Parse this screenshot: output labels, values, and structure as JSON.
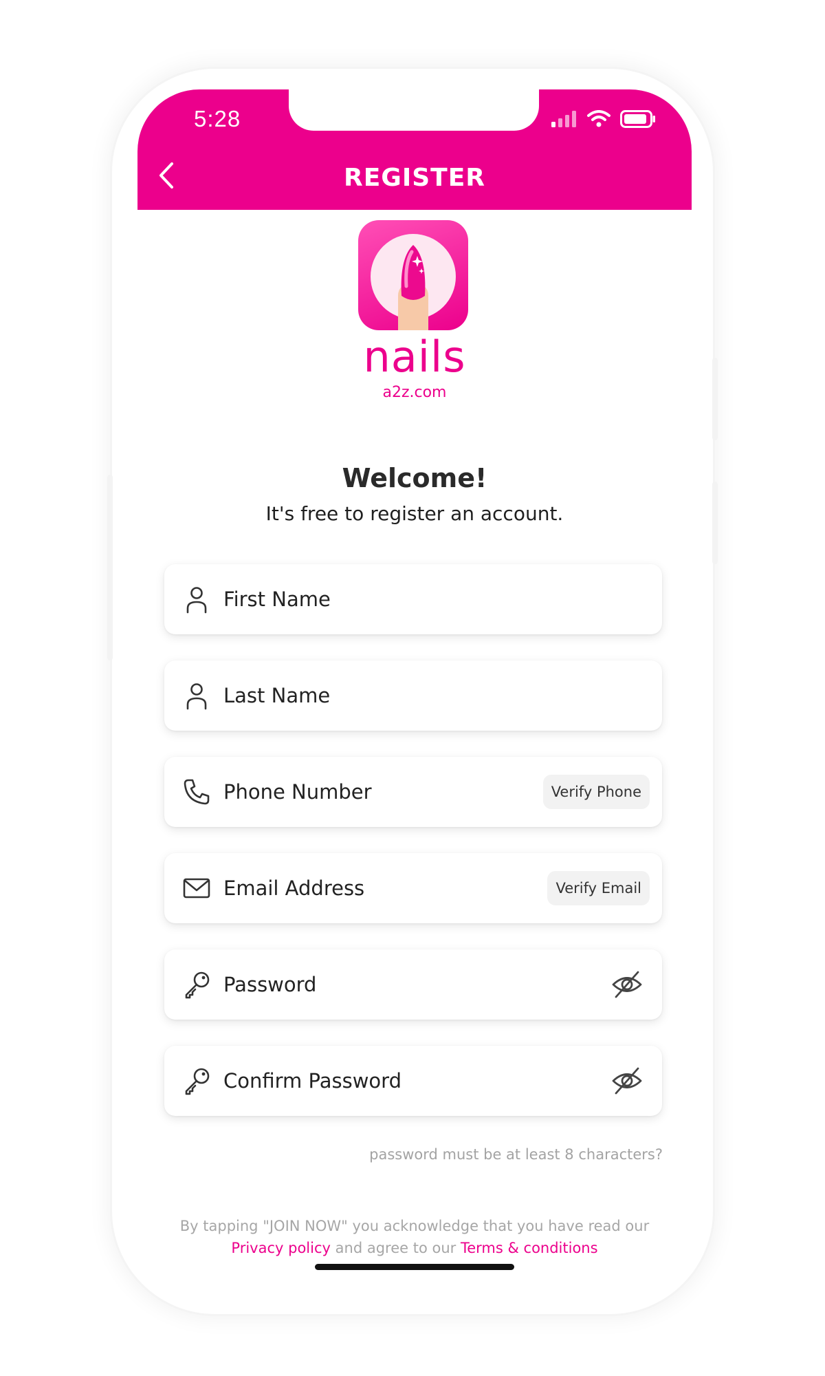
{
  "status_bar": {
    "time": "5:28"
  },
  "header": {
    "title": "REGISTER"
  },
  "logo": {
    "brand": "nails",
    "sub": "a2z.com"
  },
  "welcome": {
    "title": "Welcome!",
    "subtitle": "It's free to register an account."
  },
  "form": {
    "first_name": {
      "placeholder": "First Name",
      "icon": "user-icon"
    },
    "last_name": {
      "placeholder": "Last Name",
      "icon": "user-icon"
    },
    "phone": {
      "placeholder": "Phone Number",
      "icon": "phone-icon",
      "verify_label": "Verify Phone"
    },
    "email": {
      "placeholder": "Email Address",
      "icon": "mail-icon",
      "verify_label": "Verify Email"
    },
    "password": {
      "placeholder": "Password",
      "icon": "key-icon",
      "toggle_icon": "eye-off-icon"
    },
    "confirm_password": {
      "placeholder": "Confirm Password",
      "icon": "key-icon",
      "toggle_icon": "eye-off-icon"
    },
    "password_hint": "password must be at least 8 characters?"
  },
  "legal": {
    "line1": "By tapping \"JOIN NOW\" you acknowledge that you have read our",
    "privacy_link": "Privacy policy",
    "middle": "and agree to our",
    "terms_link": "Terms & conditions"
  },
  "colors": {
    "accent": "#ec008c",
    "text": "#222222",
    "muted": "#a6a6a6"
  }
}
